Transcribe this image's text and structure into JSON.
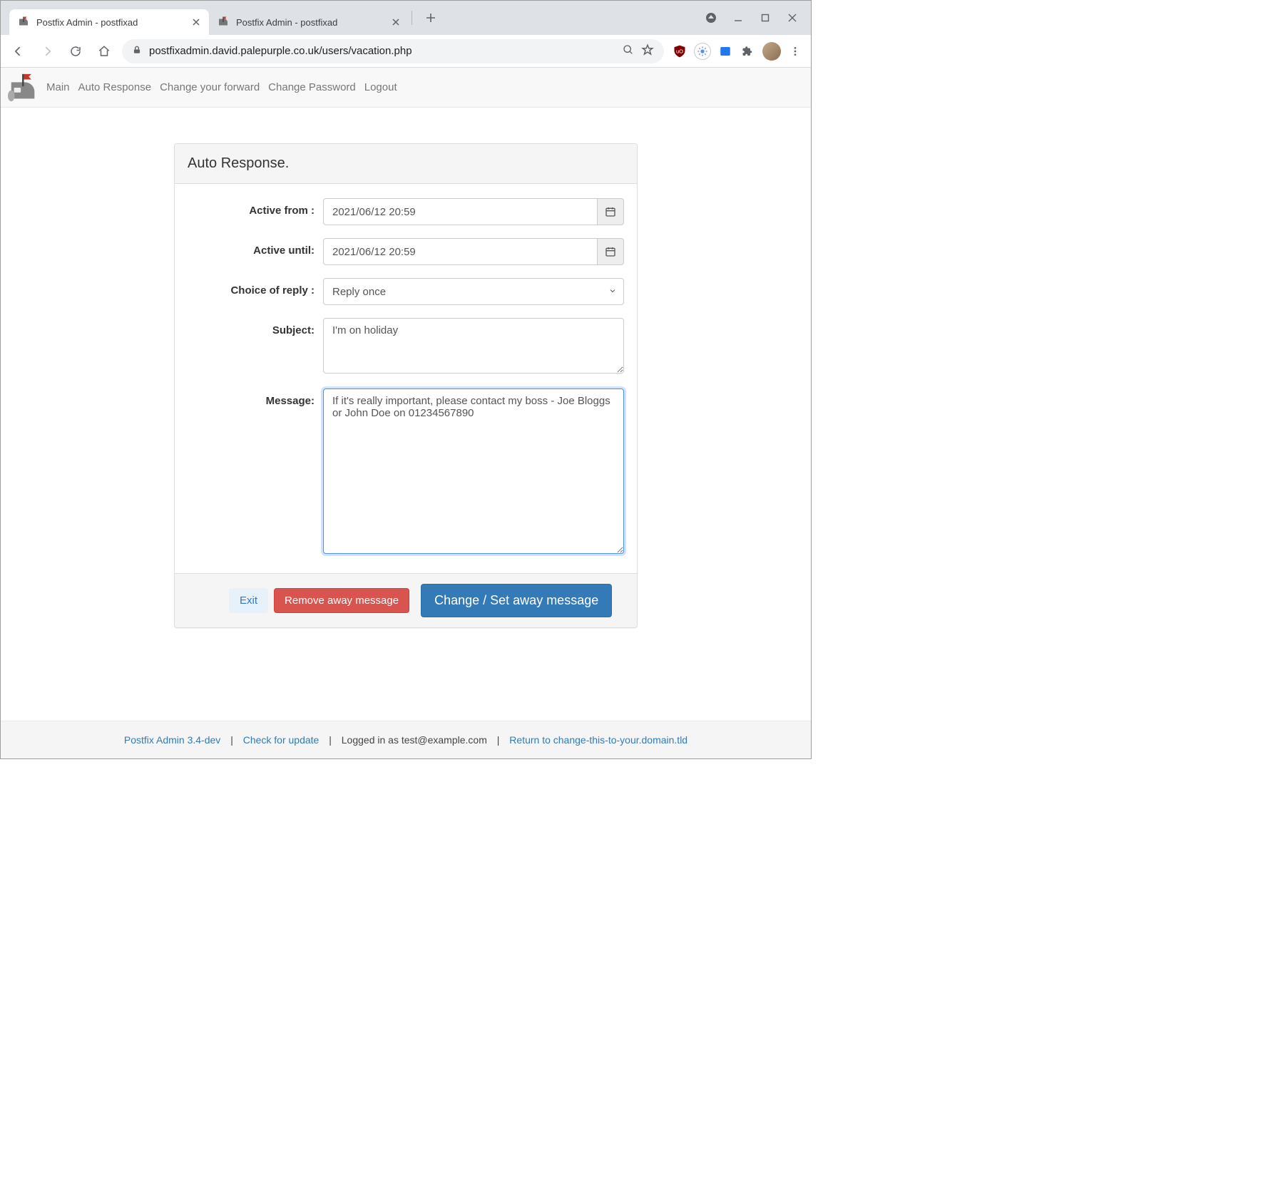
{
  "window": {
    "tabs": [
      {
        "title": "Postfix Admin - postfixad",
        "active": true
      },
      {
        "title": "Postfix Admin - postfixad",
        "active": false
      }
    ]
  },
  "toolbar": {
    "url": "postfixadmin.david.palepurple.co.uk/users/vacation.php"
  },
  "nav": {
    "items": [
      "Main",
      "Auto Response",
      "Change your forward",
      "Change Password",
      "Logout"
    ]
  },
  "panel": {
    "title": "Auto Response.",
    "labels": {
      "active_from": "Active from :",
      "active_until": "Active until:",
      "choice": "Choice of reply :",
      "subject": "Subject:",
      "message": "Message:"
    },
    "values": {
      "active_from": "2021/06/12 20:59",
      "active_until": "2021/06/12 20:59",
      "choice": "Reply once",
      "subject": "I'm on holiday",
      "message": "If it's really important, please contact my boss - Joe Bloggs or John Doe on 01234567890"
    },
    "buttons": {
      "exit": "Exit",
      "remove": "Remove away message",
      "change": "Change / Set away message"
    }
  },
  "footer": {
    "version_link": "Postfix Admin 3.4-dev",
    "check_update": "Check for update",
    "logged_in": "Logged in as test@example.com",
    "return_link": "Return to change-this-to-your.domain.tld"
  }
}
